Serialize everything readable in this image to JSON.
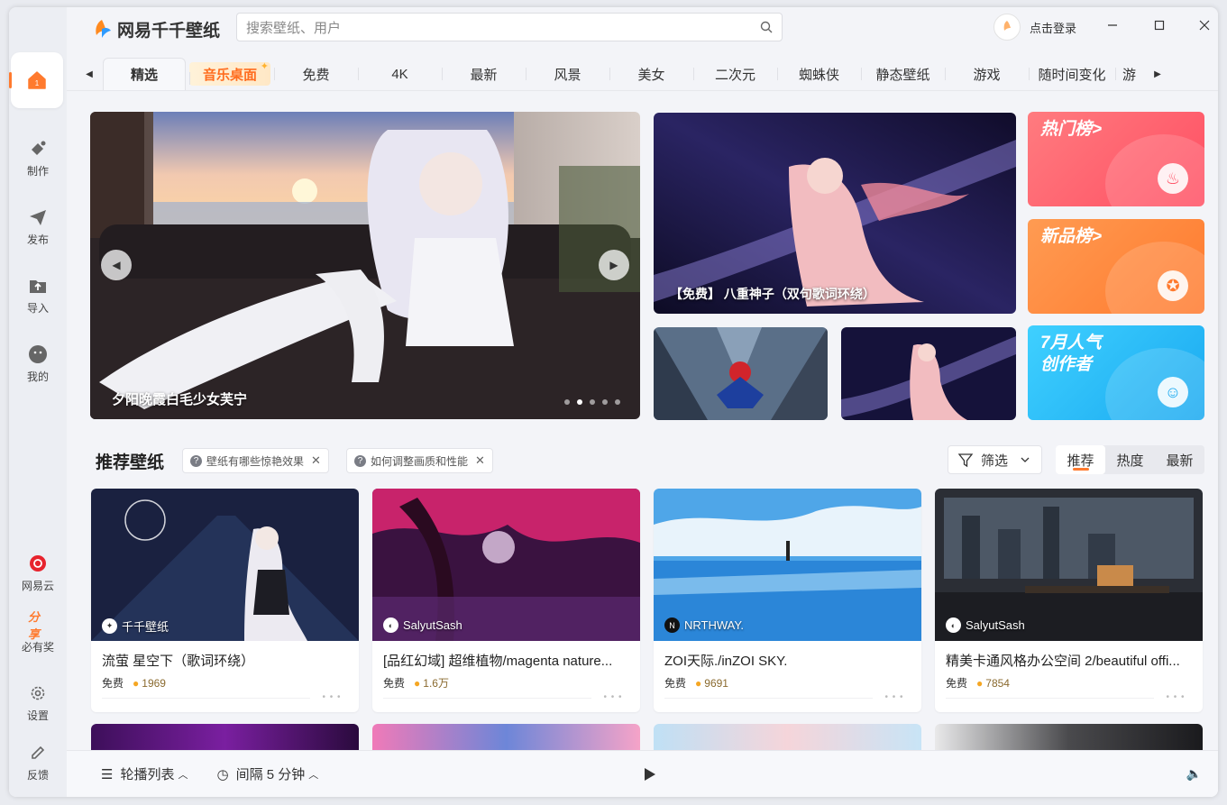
{
  "app": {
    "name": "网易千千壁纸"
  },
  "search": {
    "placeholder": "搜索壁纸、用户"
  },
  "header": {
    "login_label": "点击登录"
  },
  "sidebar": {
    "home_badge": "1",
    "items": [
      {
        "label": "制作",
        "icon": "paint-bucket-icon"
      },
      {
        "label": "发布",
        "icon": "send-icon"
      },
      {
        "label": "导入",
        "icon": "import-folder-icon"
      },
      {
        "label": "我的",
        "icon": "smiley-icon"
      }
    ],
    "bottom_items": [
      {
        "label": "网易云",
        "icon": "netease-cloud-icon"
      },
      {
        "label": "必有奖",
        "icon": "share-icon",
        "top_text": "分享"
      },
      {
        "label": "设置",
        "icon": "gear-icon"
      },
      {
        "label": "反馈",
        "icon": "pencil-icon"
      }
    ]
  },
  "tabs": [
    "精选",
    "音乐桌面",
    "免费",
    "4K",
    "最新",
    "风景",
    "美女",
    "二次元",
    "蜘蛛侠",
    "静态壁纸",
    "游戏",
    "随时间变化",
    "游"
  ],
  "banners": {
    "main_title": "夕阳晚霞白毛少女芙宁",
    "feature_caption": "【免费】 八重神子（双句歌词环绕）",
    "ranks": [
      {
        "title": "热门榜>",
        "color": "#ff5a6a"
      },
      {
        "title": "新品榜>",
        "color": "#ff8a3a"
      },
      {
        "title": "7月人气",
        "title2": "创作者",
        "color": "#22bff6"
      }
    ]
  },
  "recommend": {
    "title": "推荐壁纸",
    "chips": [
      "壁纸有哪些惊艳效果",
      "如何调整画质和性能"
    ],
    "filter_label": "筛选",
    "sort_options": [
      "推荐",
      "热度",
      "最新"
    ],
    "cards": [
      {
        "author": "千千壁纸",
        "title": "流萤 星空下（歌词环绕）",
        "price": "免费",
        "count": "1969"
      },
      {
        "author": "SalyutSash",
        "title": "[品红幻域] 超维植物/magenta nature...",
        "price": "免费",
        "count": "1.6万"
      },
      {
        "author": "NRTHWAY.",
        "title": "ZOI天际./inZOI SKY.",
        "price": "免费",
        "count": "9691"
      },
      {
        "author": "SalyutSash",
        "title": "精美卡通风格办公空间 2/beautiful offi...",
        "price": "免费",
        "count": "7854"
      }
    ]
  },
  "bottombar": {
    "playlist_label": "轮播列表",
    "interval_label": "间隔 5 分钟"
  }
}
